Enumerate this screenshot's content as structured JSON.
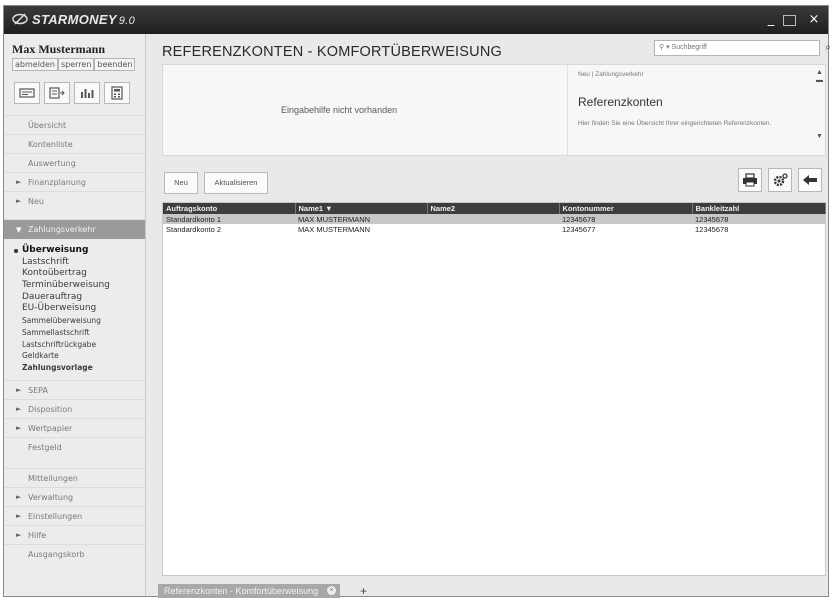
{
  "app": {
    "name": "STARMONEY",
    "version": "9.0"
  },
  "window_controls": {
    "minimize": "_",
    "maximize": "□",
    "close": "×"
  },
  "sidebar": {
    "user_name": "Max Mustermann",
    "account_actions": [
      "abmelden",
      "sperren",
      "beenden"
    ],
    "toolbar_icons": [
      "accounts-icon",
      "transfer-icon",
      "chart-icon",
      "calculator-icon"
    ],
    "nav_top": [
      {
        "label": "Übersicht",
        "arrow": false
      },
      {
        "label": "Kontenliste",
        "arrow": false
      },
      {
        "label": "Auswertung",
        "arrow": false
      },
      {
        "label": "Finanzplanung",
        "arrow": true
      },
      {
        "label": "Neu",
        "arrow": true
      }
    ],
    "active_section": {
      "label": "Zahlungsverkehr",
      "arrow": "▼"
    },
    "sub_items": [
      {
        "label": "Überweisung",
        "style": "sel"
      },
      {
        "label": "Lastschrift",
        "style": ""
      },
      {
        "label": "Kontoübertrag",
        "style": ""
      },
      {
        "label": "Terminüberweisung",
        "style": ""
      },
      {
        "label": "Dauerauftrag",
        "style": ""
      },
      {
        "label": "EU-Überweisung",
        "style": ""
      },
      {
        "label": "Sammelüberweisung",
        "style": "small"
      },
      {
        "label": "Sammellastschrift",
        "style": "small"
      },
      {
        "label": "Lastschriftrückgabe",
        "style": "small"
      },
      {
        "label": "Geldkarte",
        "style": "small"
      },
      {
        "label": "Zahlungsvorlage",
        "style": "bold"
      }
    ],
    "nav_mid": [
      {
        "label": "SEPA",
        "arrow": true
      },
      {
        "label": "Disposition",
        "arrow": true
      },
      {
        "label": "Wertpapier",
        "arrow": true
      },
      {
        "label": "Festgeld",
        "arrow": false
      }
    ],
    "nav_bottom": [
      {
        "label": "Mitteilungen",
        "arrow": false
      },
      {
        "label": "Verwaltung",
        "arrow": true
      },
      {
        "label": "Einstellungen",
        "arrow": true
      },
      {
        "label": "Hilfe",
        "arrow": true
      },
      {
        "label": "Ausgangskorb",
        "arrow": false
      }
    ]
  },
  "main": {
    "title": "REFERENZKONTEN - KOMFORTÜBERWEISUNG",
    "search_placeholder": "Suchbegriff",
    "hint_text": "Eingabehilfe nicht vorhanden",
    "info_panel": {
      "breadcrumb": "Neu | Zahlungsverkehr",
      "heading": "Referenzkonten",
      "text": "Hier finden Sie eine Übersicht Ihrer eingerichteten Referenzkonten."
    },
    "buttons": {
      "new": "Neu",
      "refresh": "Aktualisieren"
    },
    "toolbar_icons": [
      "print-icon",
      "settings-icon",
      "back-arrow-icon"
    ],
    "table": {
      "columns": [
        "Auftragskonto",
        "Name1 ▼",
        "Name2",
        "Kontonummer",
        "Bankleitzahl"
      ],
      "rows": [
        [
          "Standardkonto 1",
          "MAX MUSTERMANN",
          "",
          "12345678",
          "12345678"
        ],
        [
          "Standardkonto 2",
          "MAX MUSTERMANN",
          "",
          "12345677",
          "12345678"
        ]
      ]
    },
    "tabs": [
      {
        "label": "Referenzkonten - Komfortüberweisung"
      }
    ],
    "add_tab": "+"
  }
}
